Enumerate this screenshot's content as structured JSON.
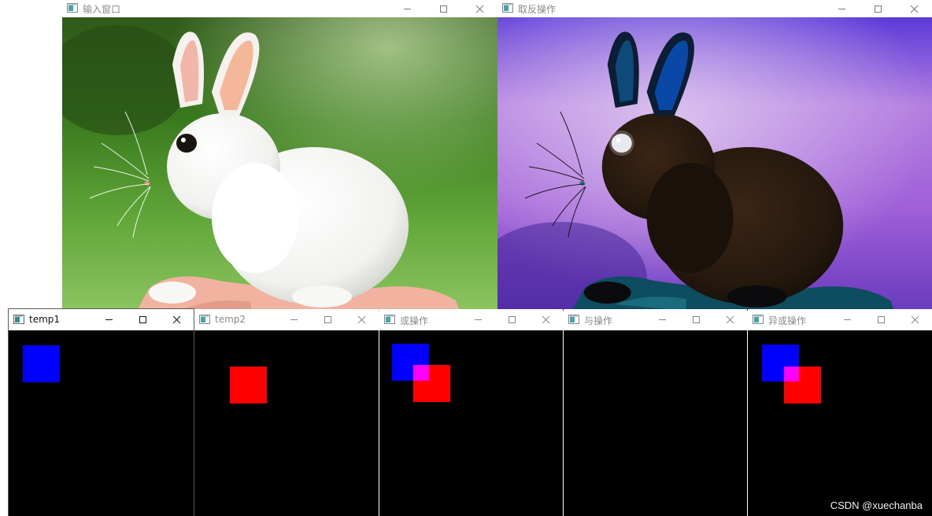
{
  "colors": {
    "blue": "#0000ff",
    "red": "#ff0000",
    "overlap": "#ff00ff",
    "canvas": "#000000"
  },
  "windows": [
    {
      "title": "输入窗口",
      "content": "rabbit photo (original)"
    },
    {
      "title": "取反操作",
      "content": "rabbit photo (inverted)"
    },
    {
      "title": "temp1",
      "content": "blue square"
    },
    {
      "title": "temp2",
      "content": "red square"
    },
    {
      "title": "或操作",
      "content": "blue and red squares, overlap magenta"
    },
    {
      "title": "与操作",
      "content": "empty black"
    },
    {
      "title": "异或操作",
      "content": "blue and red squares, overlap magenta"
    }
  ],
  "watermark": "CSDN @xuechanba"
}
